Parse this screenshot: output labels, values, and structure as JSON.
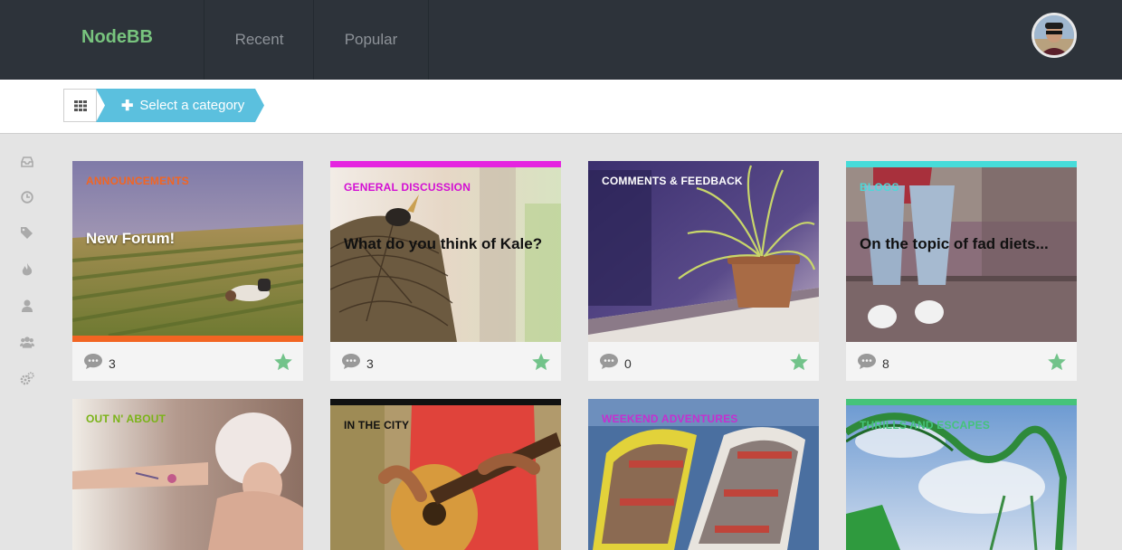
{
  "header": {
    "brand": "NodeBB",
    "nav": [
      "Recent",
      "Popular"
    ]
  },
  "subbar": {
    "category_button": "Select a category"
  },
  "sidebar": {
    "icons": [
      "inbox-icon",
      "clock-icon",
      "tags-icon",
      "fire-icon",
      "user-icon",
      "users-icon",
      "cogs-icon"
    ]
  },
  "colors": {
    "accent": "#78c47e",
    "category_button": "#5bc0de",
    "star": "#72c38a"
  },
  "categories": [
    {
      "label": "ANNOUNCEMENTS",
      "title": "New Forum!",
      "count": "3",
      "label_color": "#f26522",
      "bar_color": "#f26522"
    },
    {
      "label": "GENERAL DISCUSSION",
      "title": "What do you think of Kale?",
      "count": "3",
      "label_color": "#d30fd3",
      "bar_color": "#e524e0"
    },
    {
      "label": "COMMENTS & FEEDBACK",
      "title": "",
      "count": "0",
      "label_color": "#ffffff",
      "bar_color": ""
    },
    {
      "label": "BLOGS",
      "title": "On the topic of fad diets...",
      "count": "8",
      "label_color": "#4dd8d8",
      "bar_color": "#46dcd9"
    },
    {
      "label": "OUT N' ABOUT",
      "title": "",
      "count": "",
      "label_color": "#7ab317",
      "bar_color": ""
    },
    {
      "label": "IN THE CITY",
      "title": "",
      "count": "",
      "label_color": "#111111",
      "bar_color": "#111111"
    },
    {
      "label": "WEEKEND ADVENTURES",
      "title": "",
      "count": "",
      "label_color": "#c52fd0",
      "bar_color": ""
    },
    {
      "label": "THRILLS AND ESCAPES",
      "title": "",
      "count": "",
      "label_color": "#45c37a",
      "bar_color": "#45c37a"
    }
  ]
}
